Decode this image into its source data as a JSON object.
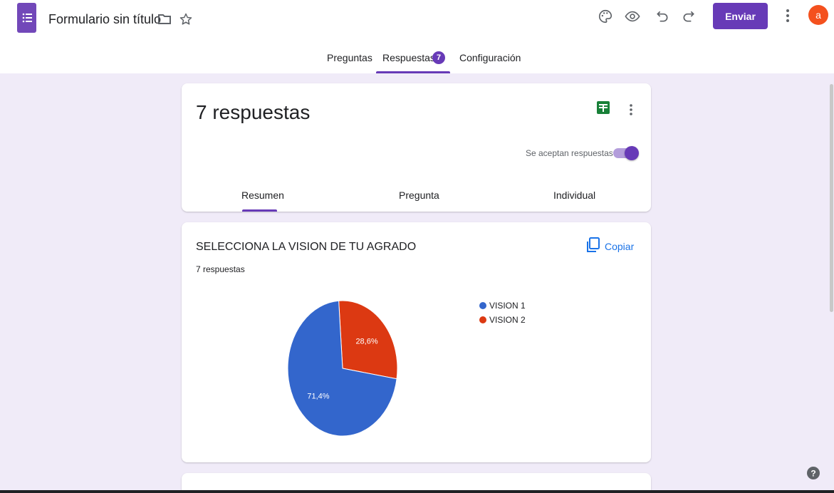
{
  "app": {
    "doc_title": "Formulario sin título",
    "send_label": "Enviar",
    "avatar_letter": "a",
    "icons": [
      "forms-icon",
      "folder-icon",
      "star-icon",
      "palette-icon",
      "eye-icon",
      "undo-icon",
      "redo-icon",
      "more-vert-icon"
    ]
  },
  "tabs": {
    "preguntas": "Preguntas",
    "respuestas": "Respuestas",
    "respuestas_badge": "7",
    "configuracion": "Configuración",
    "active": "respuestas"
  },
  "summary_card": {
    "count_label": "7 respuestas",
    "accepting_label": "Se aceptan respuestas",
    "accepting": true,
    "subtabs": {
      "resumen": "Resumen",
      "pregunta": "Pregunta",
      "individual": "Individual"
    },
    "active_subtab": "resumen"
  },
  "question_card": {
    "title": "SELECCIONA LA VISION DE TU AGRADO",
    "responses": "7 respuestas",
    "copy_label": "Copiar"
  },
  "chart_data": {
    "type": "pie",
    "categories": [
      "VISION 1",
      "VISION 2"
    ],
    "values": [
      71.4,
      28.6
    ],
    "labels": [
      "71,4%",
      "28,6%"
    ],
    "colors": [
      "#3366cc",
      "#dc3912"
    ],
    "legend_position": "right"
  },
  "colors": {
    "accent": "#673ab7",
    "background": "#f0ebf8"
  }
}
